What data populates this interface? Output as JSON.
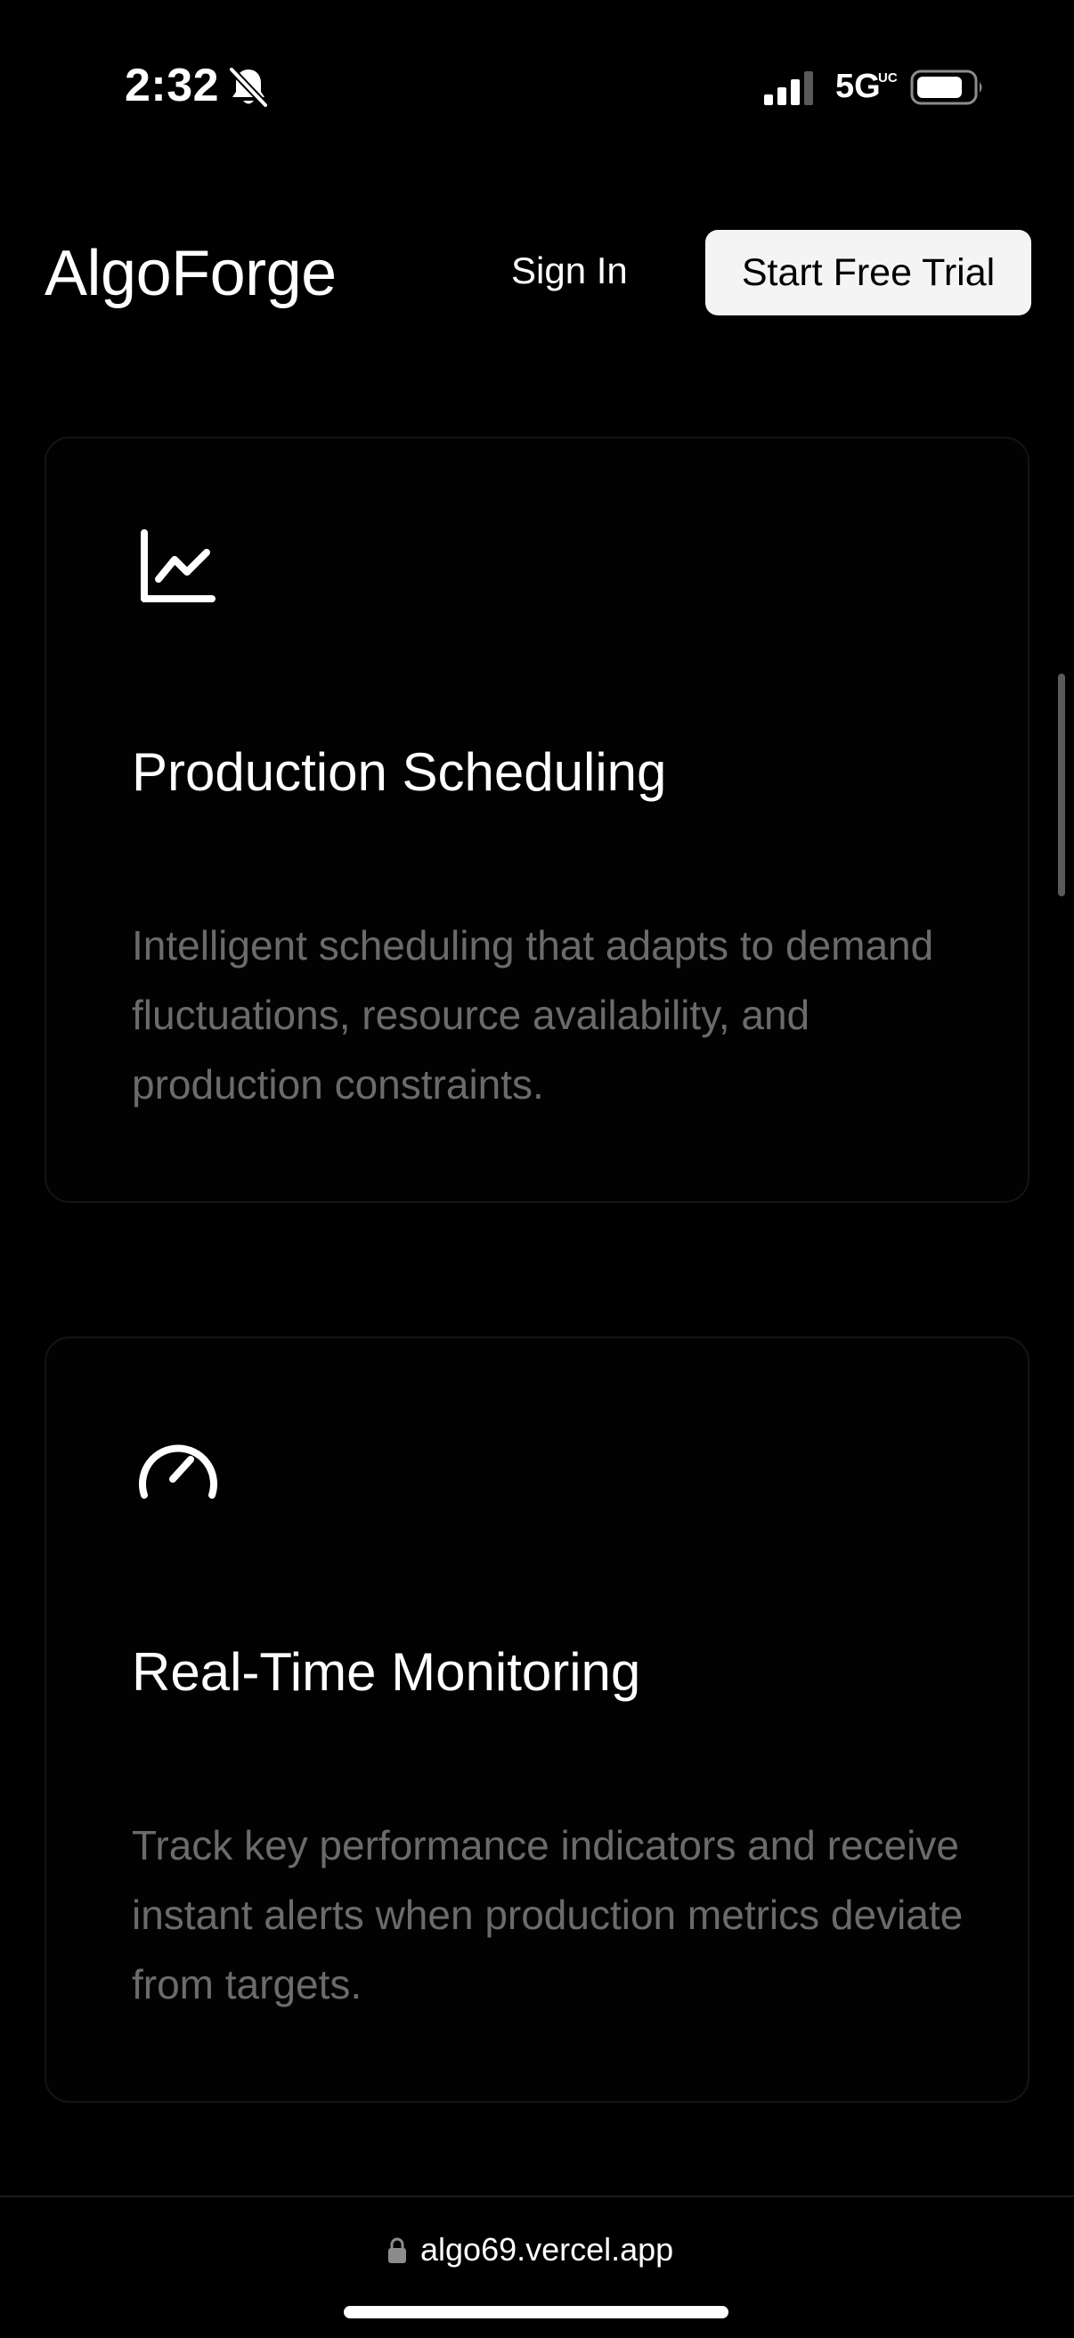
{
  "status_bar": {
    "time": "2:32",
    "network": "5G",
    "network_sup": "UC",
    "icons": [
      "bell-slash-icon",
      "signal-icon",
      "battery-icon"
    ]
  },
  "header": {
    "brand": "AlgoForge",
    "sign_in": "Sign In",
    "cta": "Start Free Trial"
  },
  "features": [
    {
      "icon": "line-chart-icon",
      "title": "Production Scheduling",
      "description": "Intelligent scheduling that adapts to demand fluctuations, resource availability, and production constraints."
    },
    {
      "icon": "gauge-icon",
      "title": "Real-Time Monitoring",
      "description": "Track key performance indicators and receive instant alerts when production metrics deviate from targets."
    }
  ],
  "browser": {
    "url": "algo69.vercel.app",
    "icon": "lock-icon"
  },
  "colors": {
    "background": "#000000",
    "text": "#ffffff",
    "muted_text": "#6b6b6b",
    "cta_background": "#f4f4f4",
    "card_border": "#141414"
  }
}
